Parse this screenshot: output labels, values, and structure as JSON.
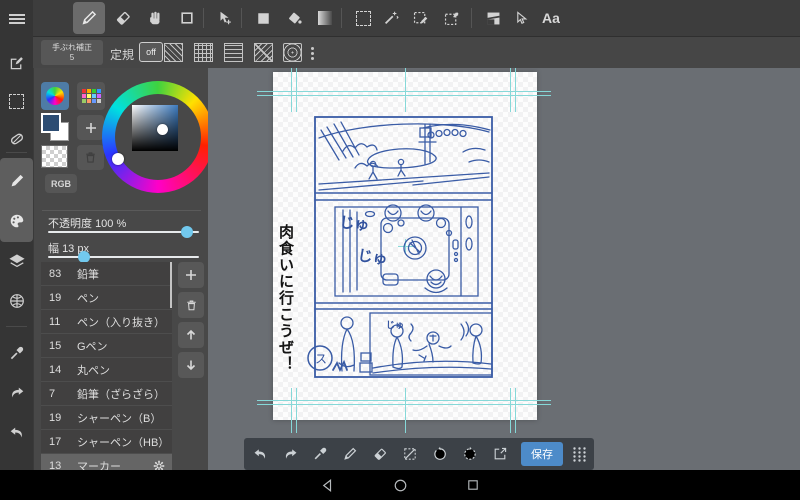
{
  "toolbar_main": {
    "text_tool_label": "Aa",
    "icons": [
      "menu",
      "pencil",
      "eraser",
      "hand",
      "frame",
      "move",
      "shape-square",
      "bucket",
      "gradient",
      "marquee-select",
      "magic-wand",
      "select-edit",
      "select-pen",
      "panel-divide",
      "cursor",
      "text"
    ]
  },
  "toolbar_ruler": {
    "stabilization_label": "手ぶれ補正",
    "stabilization_value": "5",
    "ruler_label": "定規",
    "off_label": "off",
    "icons": [
      "parallel-ruler",
      "grid-ruler",
      "horizontal-ruler",
      "vanishing-ruler",
      "concentric-ruler",
      "more"
    ]
  },
  "sidebar": {
    "icons": [
      "menu",
      "new-canvas",
      "select",
      "transform",
      "brush",
      "palette",
      "layers",
      "snap",
      "eyedropper",
      "redo",
      "undo"
    ]
  },
  "color_panel": {
    "rgb_label": "RGB",
    "opacity_label": "不透明度",
    "opacity_value": "100 %",
    "width_label": "幅",
    "width_value": "13 px"
  },
  "brushes": {
    "items": [
      {
        "size": "83",
        "name": "鉛筆"
      },
      {
        "size": "19",
        "name": "ペン"
      },
      {
        "size": "11",
        "name": "ペン（入り抜き）"
      },
      {
        "size": "15",
        "name": "Gペン"
      },
      {
        "size": "14",
        "name": "丸ペン"
      },
      {
        "size": "7",
        "name": "鉛筆（ざらざら）"
      },
      {
        "size": "19",
        "name": "シャーペン（B）"
      },
      {
        "size": "17",
        "name": "シャーペン（HB）"
      },
      {
        "size": "13",
        "name": "マーカー"
      }
    ],
    "selected": "マーカー"
  },
  "bottom_toolbar": {
    "save_label": "保存",
    "icons": [
      "undo",
      "redo",
      "eyedropper",
      "pen",
      "eraser",
      "deselect",
      "rotate-ccw",
      "rotate-cw",
      "export",
      "save",
      "grid-menu"
    ]
  },
  "canvas": {
    "speech_text": "肉食いに行こうぜ！",
    "sfx": [
      "じゅ",
      "じゅ",
      "じゅ"
    ],
    "panel_label": "ス"
  },
  "android_nav": {
    "icons": [
      "back",
      "home",
      "recents"
    ]
  },
  "colors": {
    "accent_save_blue": "#4d8bc9",
    "sketch_blue": "#3a5ca6",
    "guide_cyan": "#86d8d8",
    "slider_thumb_blue": "#72c9ee",
    "foreground_color": "#2d4d73",
    "workspace_gray": "#6a6e73"
  }
}
